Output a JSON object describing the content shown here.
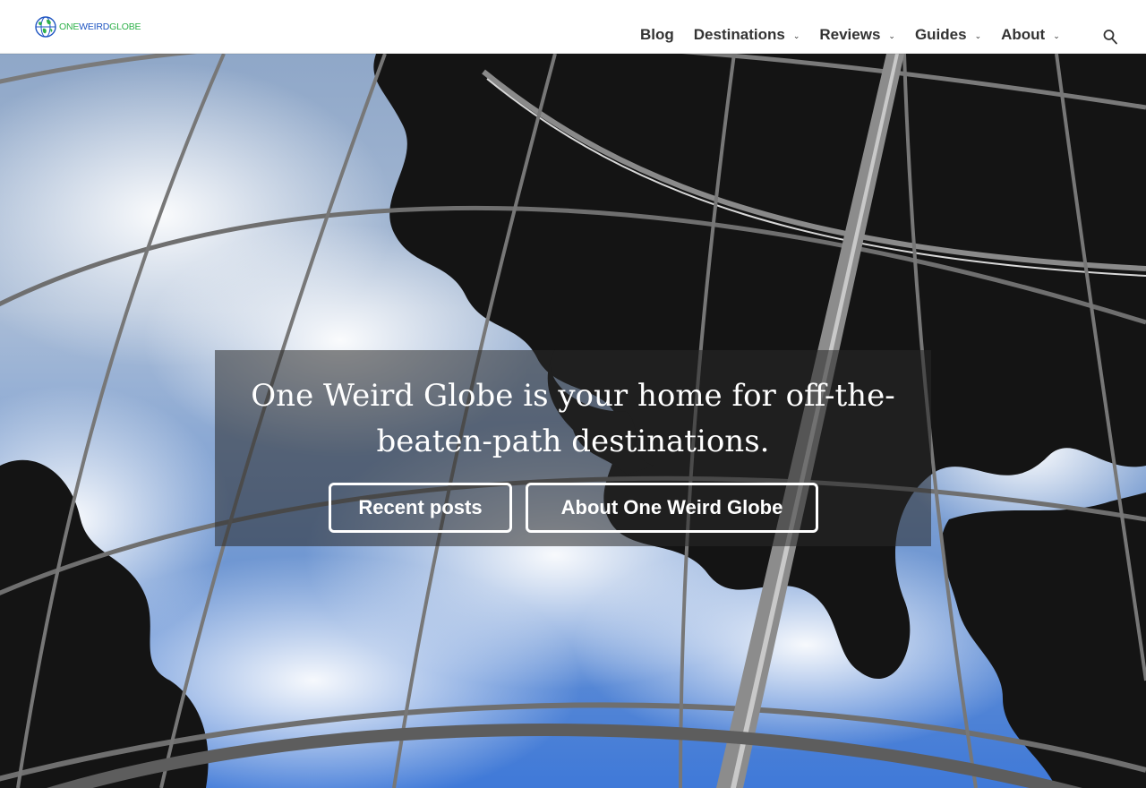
{
  "logo": {
    "part1": "ONE",
    "part2": "WEIRD",
    "part3": "GLOBE",
    "colors": {
      "green": "#2fb14a",
      "blue": "#1f55c2"
    }
  },
  "nav": {
    "items": [
      {
        "label": "Blog",
        "has_dropdown": false
      },
      {
        "label": "Destinations",
        "has_dropdown": true
      },
      {
        "label": "Reviews",
        "has_dropdown": true
      },
      {
        "label": "Guides",
        "has_dropdown": true
      },
      {
        "label": "About",
        "has_dropdown": true
      }
    ],
    "dropdown_icon": "chevron-down-icon",
    "search_icon": "search-icon"
  },
  "hero": {
    "title": "One Weird Globe is your home for off-the-beaten-path destinations.",
    "buttons": {
      "recent": "Recent posts",
      "about": "About One Weird Globe"
    },
    "overlay_color": "#282828"
  }
}
